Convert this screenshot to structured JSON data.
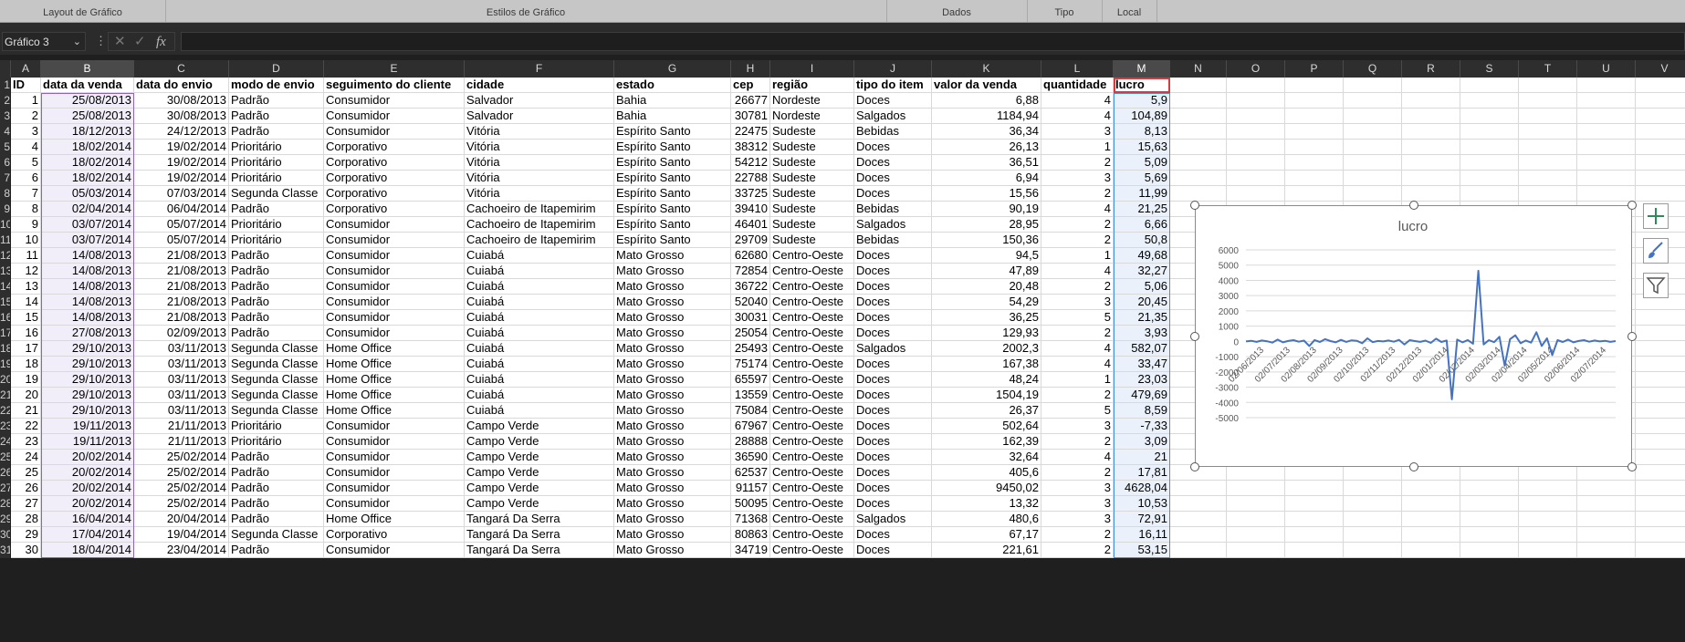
{
  "ribbon": {
    "groups": [
      "Layout de Gráfico",
      "Estilos de Gráfico",
      "Dados",
      "Tipo",
      "Local"
    ]
  },
  "formula_bar": {
    "name_box": "Gráfico 3",
    "fx_label": "fx",
    "cancel_symbol": "✕",
    "enter_symbol": "✓",
    "value": ""
  },
  "columns": [
    "A",
    "B",
    "C",
    "D",
    "E",
    "F",
    "G",
    "H",
    "I",
    "J",
    "K",
    "L",
    "M",
    "N",
    "O",
    "P",
    "Q",
    "R",
    "S",
    "T",
    "U",
    "V"
  ],
  "headers": [
    "ID",
    "data da venda",
    "data do envio",
    "modo de envio",
    "seguimento do cliente",
    "cidade",
    "estado",
    "cep",
    "região",
    "tipo do item",
    "valor da venda",
    "quantidade",
    "lucro"
  ],
  "rows": [
    [
      "1",
      "25/08/2013",
      "30/08/2013",
      "Padrão",
      "Consumidor",
      "Salvador",
      "Bahia",
      "26677",
      "Nordeste",
      "Doces",
      "6,88",
      "4",
      "5,9"
    ],
    [
      "2",
      "25/08/2013",
      "30/08/2013",
      "Padrão",
      "Consumidor",
      "Salvador",
      "Bahia",
      "30781",
      "Nordeste",
      "Salgados",
      "1184,94",
      "4",
      "104,89"
    ],
    [
      "3",
      "18/12/2013",
      "24/12/2013",
      "Padrão",
      "Consumidor",
      "Vitória",
      "Espírito Santo",
      "22475",
      "Sudeste",
      "Bebidas",
      "36,34",
      "3",
      "8,13"
    ],
    [
      "4",
      "18/02/2014",
      "19/02/2014",
      "Prioritário",
      "Corporativo",
      "Vitória",
      "Espírito Santo",
      "38312",
      "Sudeste",
      "Doces",
      "26,13",
      "1",
      "15,63"
    ],
    [
      "5",
      "18/02/2014",
      "19/02/2014",
      "Prioritário",
      "Corporativo",
      "Vitória",
      "Espírito Santo",
      "54212",
      "Sudeste",
      "Doces",
      "36,51",
      "2",
      "5,09"
    ],
    [
      "6",
      "18/02/2014",
      "19/02/2014",
      "Prioritário",
      "Corporativo",
      "Vitória",
      "Espírito Santo",
      "22788",
      "Sudeste",
      "Doces",
      "6,94",
      "3",
      "5,69"
    ],
    [
      "7",
      "05/03/2014",
      "07/03/2014",
      "Segunda Classe",
      "Corporativo",
      "Vitória",
      "Espírito Santo",
      "33725",
      "Sudeste",
      "Doces",
      "15,56",
      "2",
      "11,99"
    ],
    [
      "8",
      "02/04/2014",
      "06/04/2014",
      "Padrão",
      "Corporativo",
      "Cachoeiro de Itapemirim",
      "Espírito Santo",
      "39410",
      "Sudeste",
      "Bebidas",
      "90,19",
      "4",
      "21,25"
    ],
    [
      "9",
      "03/07/2014",
      "05/07/2014",
      "Prioritário",
      "Consumidor",
      "Cachoeiro de Itapemirim",
      "Espírito Santo",
      "46401",
      "Sudeste",
      "Salgados",
      "28,95",
      "2",
      "6,66"
    ],
    [
      "10",
      "03/07/2014",
      "05/07/2014",
      "Prioritário",
      "Consumidor",
      "Cachoeiro de Itapemirim",
      "Espírito Santo",
      "29709",
      "Sudeste",
      "Bebidas",
      "150,36",
      "2",
      "50,8"
    ],
    [
      "11",
      "14/08/2013",
      "21/08/2013",
      "Padrão",
      "Consumidor",
      "Cuiabá",
      "Mato Grosso",
      "62680",
      "Centro-Oeste",
      "Doces",
      "94,5",
      "1",
      "49,68"
    ],
    [
      "12",
      "14/08/2013",
      "21/08/2013",
      "Padrão",
      "Consumidor",
      "Cuiabá",
      "Mato Grosso",
      "72854",
      "Centro-Oeste",
      "Doces",
      "47,89",
      "4",
      "32,27"
    ],
    [
      "13",
      "14/08/2013",
      "21/08/2013",
      "Padrão",
      "Consumidor",
      "Cuiabá",
      "Mato Grosso",
      "36722",
      "Centro-Oeste",
      "Doces",
      "20,48",
      "2",
      "5,06"
    ],
    [
      "14",
      "14/08/2013",
      "21/08/2013",
      "Padrão",
      "Consumidor",
      "Cuiabá",
      "Mato Grosso",
      "52040",
      "Centro-Oeste",
      "Doces",
      "54,29",
      "3",
      "20,45"
    ],
    [
      "15",
      "14/08/2013",
      "21/08/2013",
      "Padrão",
      "Consumidor",
      "Cuiabá",
      "Mato Grosso",
      "30031",
      "Centro-Oeste",
      "Doces",
      "36,25",
      "5",
      "21,35"
    ],
    [
      "16",
      "27/08/2013",
      "02/09/2013",
      "Padrão",
      "Consumidor",
      "Cuiabá",
      "Mato Grosso",
      "25054",
      "Centro-Oeste",
      "Doces",
      "129,93",
      "2",
      "3,93"
    ],
    [
      "17",
      "29/10/2013",
      "03/11/2013",
      "Segunda Classe",
      "Home Office",
      "Cuiabá",
      "Mato Grosso",
      "25493",
      "Centro-Oeste",
      "Salgados",
      "2002,3",
      "4",
      "582,07"
    ],
    [
      "18",
      "29/10/2013",
      "03/11/2013",
      "Segunda Classe",
      "Home Office",
      "Cuiabá",
      "Mato Grosso",
      "75174",
      "Centro-Oeste",
      "Doces",
      "167,38",
      "4",
      "33,47"
    ],
    [
      "19",
      "29/10/2013",
      "03/11/2013",
      "Segunda Classe",
      "Home Office",
      "Cuiabá",
      "Mato Grosso",
      "65597",
      "Centro-Oeste",
      "Doces",
      "48,24",
      "1",
      "23,03"
    ],
    [
      "20",
      "29/10/2013",
      "03/11/2013",
      "Segunda Classe",
      "Home Office",
      "Cuiabá",
      "Mato Grosso",
      "13559",
      "Centro-Oeste",
      "Doces",
      "1504,19",
      "2",
      "479,69"
    ],
    [
      "21",
      "29/10/2013",
      "03/11/2013",
      "Segunda Classe",
      "Home Office",
      "Cuiabá",
      "Mato Grosso",
      "75084",
      "Centro-Oeste",
      "Doces",
      "26,37",
      "5",
      "8,59"
    ],
    [
      "22",
      "19/11/2013",
      "21/11/2013",
      "Prioritário",
      "Consumidor",
      "Campo Verde",
      "Mato Grosso",
      "67967",
      "Centro-Oeste",
      "Doces",
      "502,64",
      "3",
      "-7,33"
    ],
    [
      "23",
      "19/11/2013",
      "21/11/2013",
      "Prioritário",
      "Consumidor",
      "Campo Verde",
      "Mato Grosso",
      "28888",
      "Centro-Oeste",
      "Doces",
      "162,39",
      "2",
      "3,09"
    ],
    [
      "24",
      "20/02/2014",
      "25/02/2014",
      "Padrão",
      "Consumidor",
      "Campo Verde",
      "Mato Grosso",
      "36590",
      "Centro-Oeste",
      "Doces",
      "32,64",
      "4",
      "21"
    ],
    [
      "25",
      "20/02/2014",
      "25/02/2014",
      "Padrão",
      "Consumidor",
      "Campo Verde",
      "Mato Grosso",
      "62537",
      "Centro-Oeste",
      "Doces",
      "405,6",
      "2",
      "17,81"
    ],
    [
      "26",
      "20/02/2014",
      "25/02/2014",
      "Padrão",
      "Consumidor",
      "Campo Verde",
      "Mato Grosso",
      "91157",
      "Centro-Oeste",
      "Doces",
      "9450,02",
      "3",
      "4628,04"
    ],
    [
      "27",
      "20/02/2014",
      "25/02/2014",
      "Padrão",
      "Consumidor",
      "Campo Verde",
      "Mato Grosso",
      "50095",
      "Centro-Oeste",
      "Doces",
      "13,32",
      "3",
      "10,53"
    ],
    [
      "28",
      "16/04/2014",
      "20/04/2014",
      "Padrão",
      "Home Office",
      "Tangará Da Serra",
      "Mato Grosso",
      "71368",
      "Centro-Oeste",
      "Salgados",
      "480,6",
      "3",
      "72,91"
    ],
    [
      "29",
      "17/04/2014",
      "19/04/2014",
      "Segunda Classe",
      "Corporativo",
      "Tangará Da Serra",
      "Mato Grosso",
      "80863",
      "Centro-Oeste",
      "Doces",
      "67,17",
      "2",
      "16,11"
    ],
    [
      "30",
      "18/04/2014",
      "23/04/2014",
      "Padrão",
      "Consumidor",
      "Tangará Da Serra",
      "Mato Grosso",
      "34719",
      "Centro-Oeste",
      "Doces",
      "221,61",
      "2",
      "53,15"
    ]
  ],
  "chart_data": {
    "type": "line",
    "title": "lucro",
    "ylim": [
      -5000,
      6000
    ],
    "y_ticks": [
      6000,
      5000,
      4000,
      3000,
      2000,
      1000,
      0,
      -1000,
      -2000,
      -3000,
      -4000,
      -5000
    ],
    "x_ticks": [
      "02/06/2013",
      "02/07/2013",
      "02/08/2013",
      "02/09/2013",
      "02/10/2013",
      "02/11/2013",
      "02/12/2013",
      "02/01/2014",
      "02/02/2014",
      "02/03/2014",
      "02/04/2014",
      "02/05/2014",
      "02/06/2014",
      "02/07/2014"
    ],
    "grid": true,
    "legend": "none",
    "line_color": "#4472c4",
    "series": [
      {
        "values": [
          0,
          40,
          -30,
          60,
          10,
          -80,
          120,
          -60,
          30,
          80,
          -20,
          50,
          -300,
          90,
          -40,
          150,
          20,
          -60,
          100,
          -30,
          70,
          40,
          -120,
          200,
          -50,
          30,
          0,
          60,
          -20,
          100,
          -200,
          80,
          20,
          -30,
          50,
          -100,
          180,
          -40,
          60,
          -3800,
          120,
          -60,
          90,
          -150,
          4628,
          -200,
          80,
          -50,
          300,
          -1600,
          150,
          400,
          -120,
          60,
          -80,
          600,
          -300,
          200,
          -900,
          80,
          -40,
          120,
          -60,
          30,
          80,
          -20,
          60,
          0,
          40,
          -30,
          20
        ]
      }
    ]
  },
  "side_buttons": [
    "chart-elements",
    "chart-styles",
    "chart-filters"
  ]
}
